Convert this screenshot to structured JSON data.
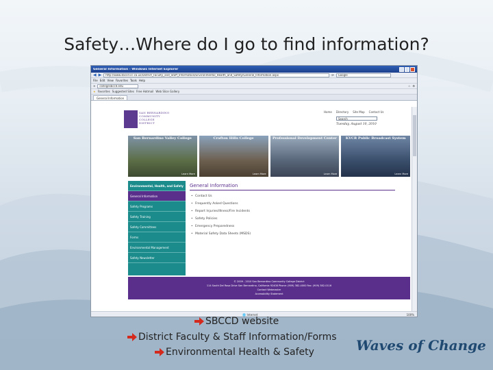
{
  "slide": {
    "title": "Safety…Where do I go to find information?",
    "tagline": "Waves of Change",
    "bullets": [
      "SBCCD website",
      "District Faculty & Staff Information/Forms",
      "Environmental Health & Safety"
    ],
    "accent_color": "#d42a1e"
  },
  "browser": {
    "window_title": "General Information - Windows Internet Explorer",
    "address": "http://www.sbccd.cc.ca.us/District_Faculty_and_Staff_Information/Environmental_Health_and_Safety/General_Information.aspx",
    "search_engine": "Google",
    "menu": [
      "File",
      "Edit",
      "View",
      "Favorites",
      "Tools",
      "Help"
    ],
    "toolbar_search": "collegesbccd.edu",
    "favorites_bar": [
      "Favorites",
      "Suggested Sites",
      "Free Hotmail",
      "Web Slice Gallery"
    ],
    "tab": "General Information",
    "status": "Internet",
    "zoom": "100%"
  },
  "site": {
    "logo_lines": [
      "SAN BERNARDINO",
      "COMMUNITY",
      "COLLEGE",
      "DISTRICT"
    ],
    "top_links": [
      "Home",
      "Directory",
      "Site Map",
      "Contact Us"
    ],
    "search_placeholder": "Search",
    "date": "Tuesday, August 10, 2010",
    "banners": [
      {
        "title": "San Bernardino Valley College",
        "link": "Learn More",
        "color": "#5c6f47"
      },
      {
        "title": "Crafton Hills College",
        "link": "Learn More",
        "color": "#6d6050"
      },
      {
        "title": "Professional Development Center",
        "link": "Learn More",
        "color": "#59677a"
      },
      {
        "title": "KVCR Public Broadcast System",
        "link": "Learn More",
        "color": "#3a4f6c"
      }
    ],
    "nav": [
      "Environmental, Health, and Safety",
      "General Information",
      "Safety Programs",
      "Safety Training",
      "Safety Committees",
      "Forms",
      "Environmental Management",
      "Safety Newsletter"
    ],
    "main_heading": "General Information",
    "main_links": [
      "Contact Us",
      "Frequently Asked Questions",
      "Report Injuries/Illness/Fire Incidents",
      "Safety Policies",
      "Emergency Preparedness",
      "Material Safety Data Sheets (MSDS)"
    ],
    "footer_lines": [
      "© 2009 - 2010 San Bernardino Community College District",
      "114 South Del Rosa Drive San Bernardino, California 92408 Phone: (909) 382-4000 Fax: (909) 382-0116",
      "Contact Webmaster",
      "Accessibility Statement"
    ]
  }
}
